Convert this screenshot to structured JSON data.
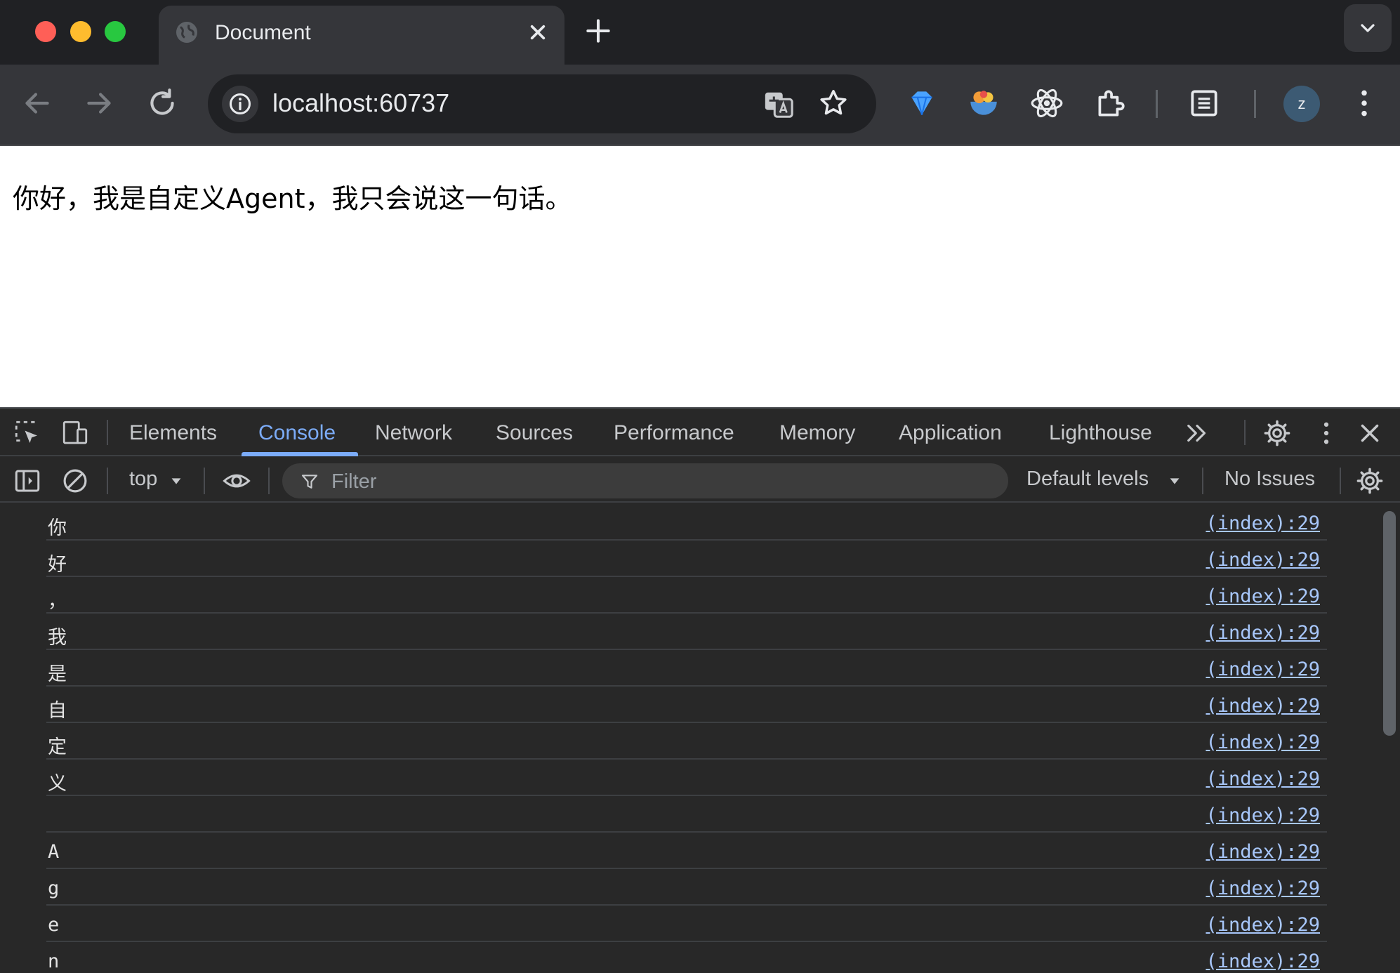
{
  "browser": {
    "tab_title": "Document",
    "url": "localhost:60737",
    "profile_initial": "z"
  },
  "page": {
    "text": "你好，我是自定义Agent，我只会说这一句话。"
  },
  "devtools": {
    "tabs": [
      "Elements",
      "Console",
      "Network",
      "Sources",
      "Performance",
      "Memory",
      "Application",
      "Lighthouse"
    ],
    "active_tab": "Console",
    "context": "top",
    "filter_placeholder": "Filter",
    "levels": "Default levels",
    "issues": "No Issues",
    "console_rows": [
      {
        "msg": "你",
        "src": "(index):29"
      },
      {
        "msg": "好",
        "src": "(index):29"
      },
      {
        "msg": "，",
        "src": "(index):29"
      },
      {
        "msg": "我",
        "src": "(index):29"
      },
      {
        "msg": "是",
        "src": "(index):29"
      },
      {
        "msg": "自",
        "src": "(index):29"
      },
      {
        "msg": "定",
        "src": "(index):29"
      },
      {
        "msg": "义",
        "src": "(index):29"
      },
      {
        "msg": "",
        "src": "(index):29"
      },
      {
        "msg": "A",
        "src": "(index):29"
      },
      {
        "msg": "g",
        "src": "(index):29"
      },
      {
        "msg": "e",
        "src": "(index):29"
      },
      {
        "msg": "n",
        "src": "(index):29"
      }
    ]
  },
  "colors": {
    "accent": "#7cacf8",
    "link": "#a8c7fa"
  }
}
